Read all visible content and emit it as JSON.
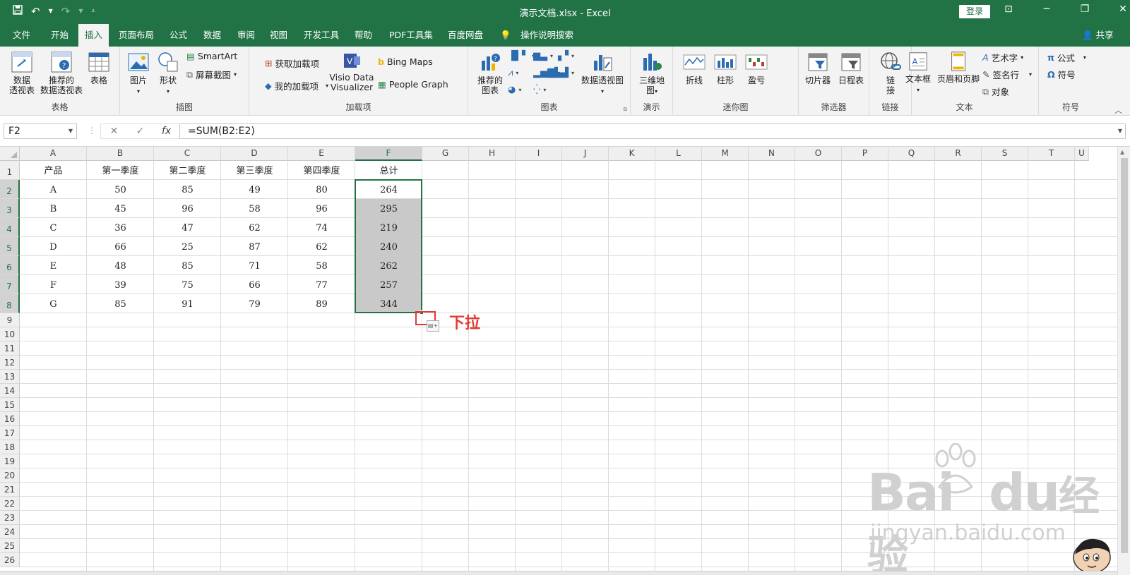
{
  "titlebar": {
    "title": "演示文档.xlsx  -  Excel",
    "login": "登录",
    "qat_icons": [
      "save-icon",
      "undo-icon",
      "redo-icon",
      "customize-icon"
    ]
  },
  "tabs": [
    "文件",
    "开始",
    "插入",
    "页面布局",
    "公式",
    "数据",
    "审阅",
    "视图",
    "开发工具",
    "帮助",
    "PDF工具集",
    "百度网盘",
    "操作说明搜索"
  ],
  "active_tab": "插入",
  "share": "共享",
  "ribbon": {
    "tables": {
      "name": "表格",
      "pivot": "数据\n透视表",
      "recommended_pivot": "推荐的\n数据透视表",
      "table": "表格"
    },
    "illustrations": {
      "name": "插图",
      "pictures": "图片",
      "shapes": "形状",
      "smartart": "SmartArt",
      "screenshot": "屏幕截图"
    },
    "addins": {
      "name": "加载项",
      "get_addins": "获取加载项",
      "my_addins": "我的加载项",
      "visio": "Visio Data\nVisualizer",
      "bing": "Bing Maps",
      "people": "People Graph"
    },
    "charts": {
      "name": "图表",
      "recommended": "推荐的\n图表",
      "pivot_chart": "数据透视图"
    },
    "tours": {
      "name": "演示",
      "map3d": "三维地\n图"
    },
    "sparklines": {
      "name": "迷你图",
      "line": "折线",
      "column": "柱形",
      "winloss": "盈亏"
    },
    "filters": {
      "name": "筛选器",
      "slicer": "切片器",
      "timeline": "日程表"
    },
    "links": {
      "name": "链接",
      "link": "链\n接"
    },
    "text": {
      "name": "文本",
      "textbox": "文本框",
      "header_footer": "页眉和页脚",
      "wordart": "艺术字",
      "signature": "签名行",
      "object": "对象"
    },
    "symbols": {
      "name": "符号",
      "equation": "公式",
      "symbol": "符号"
    }
  },
  "formula_bar": {
    "name_box": "F2",
    "formula": "=SUM(B2:E2)",
    "cancel": "✕",
    "enter": "✓",
    "fx": "fx"
  },
  "columns": [
    "A",
    "B",
    "C",
    "D",
    "E",
    "F",
    "G",
    "H",
    "I",
    "J",
    "K",
    "L",
    "M",
    "N",
    "O",
    "P",
    "Q",
    "R",
    "S",
    "T",
    "U"
  ],
  "rows": [
    "1",
    "2",
    "3",
    "4",
    "5",
    "6",
    "7",
    "8",
    "9",
    "10",
    "11",
    "12",
    "13",
    "14",
    "15",
    "16",
    "17",
    "18",
    "19",
    "20",
    "21",
    "22",
    "23",
    "24",
    "25",
    "26"
  ],
  "sheet": {
    "headers": [
      "产品",
      "第一季度",
      "第二季度",
      "第三季度",
      "第四季度",
      "总计"
    ],
    "data": [
      [
        "A",
        "50",
        "85",
        "49",
        "80",
        "264"
      ],
      [
        "B",
        "45",
        "96",
        "58",
        "96",
        "295"
      ],
      [
        "C",
        "36",
        "47",
        "62",
        "74",
        "219"
      ],
      [
        "D",
        "66",
        "25",
        "87",
        "62",
        "240"
      ],
      [
        "E",
        "48",
        "85",
        "71",
        "58",
        "262"
      ],
      [
        "F",
        "39",
        "75",
        "66",
        "77",
        "257"
      ],
      [
        "G",
        "85",
        "91",
        "79",
        "89",
        "344"
      ]
    ]
  },
  "annotation": "下拉",
  "watermark": {
    "brand": "Bai",
    "brand2": "du",
    "brand_cn": "经验",
    "url": "jingyan.baidu.com"
  },
  "colors": {
    "accent": "#217346",
    "annotation": "#e53935",
    "selection": "#c9c9c9"
  }
}
